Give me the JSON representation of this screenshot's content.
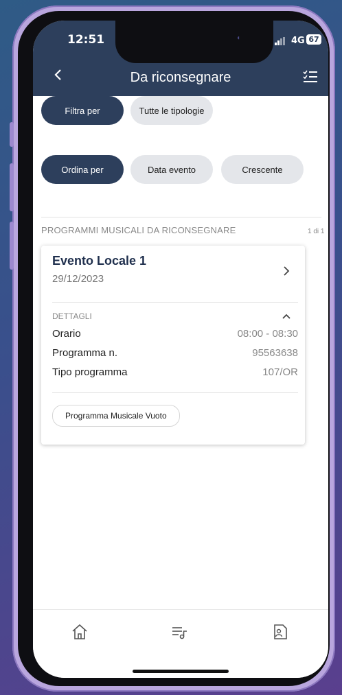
{
  "status": {
    "time": "12:51",
    "network": "4G",
    "battery": "67"
  },
  "header": {
    "title": "Da riconsegnare",
    "back_icon": "chevron-left-icon",
    "menu_icon": "checklist-icon"
  },
  "filters": {
    "filter_label": "Filtra per",
    "filter_value": "Tutte le tipologie",
    "sort_label": "Ordina per",
    "sort_field": "Data evento",
    "sort_order": "Crescente"
  },
  "section": {
    "title": "PROGRAMMI MUSICALI DA RICONSEGNARE",
    "pager": "1 di 1"
  },
  "card": {
    "event_name": "Evento Locale 1",
    "event_date": "29/12/2023",
    "details_label": "DETTAGLI",
    "rows": [
      {
        "label": "Orario",
        "value": "08:00 - 08:30"
      },
      {
        "label": "Programma n.",
        "value": "95563638"
      },
      {
        "label": "Tipo programma",
        "value": "107/OR"
      }
    ],
    "action_label": "Programma Musicale Vuoto"
  },
  "tabbar": {
    "items": [
      "home-icon",
      "music-list-icon",
      "user-document-icon"
    ]
  },
  "colors": {
    "primary": "#2d3f5c",
    "chip": "#e4e6ea"
  }
}
